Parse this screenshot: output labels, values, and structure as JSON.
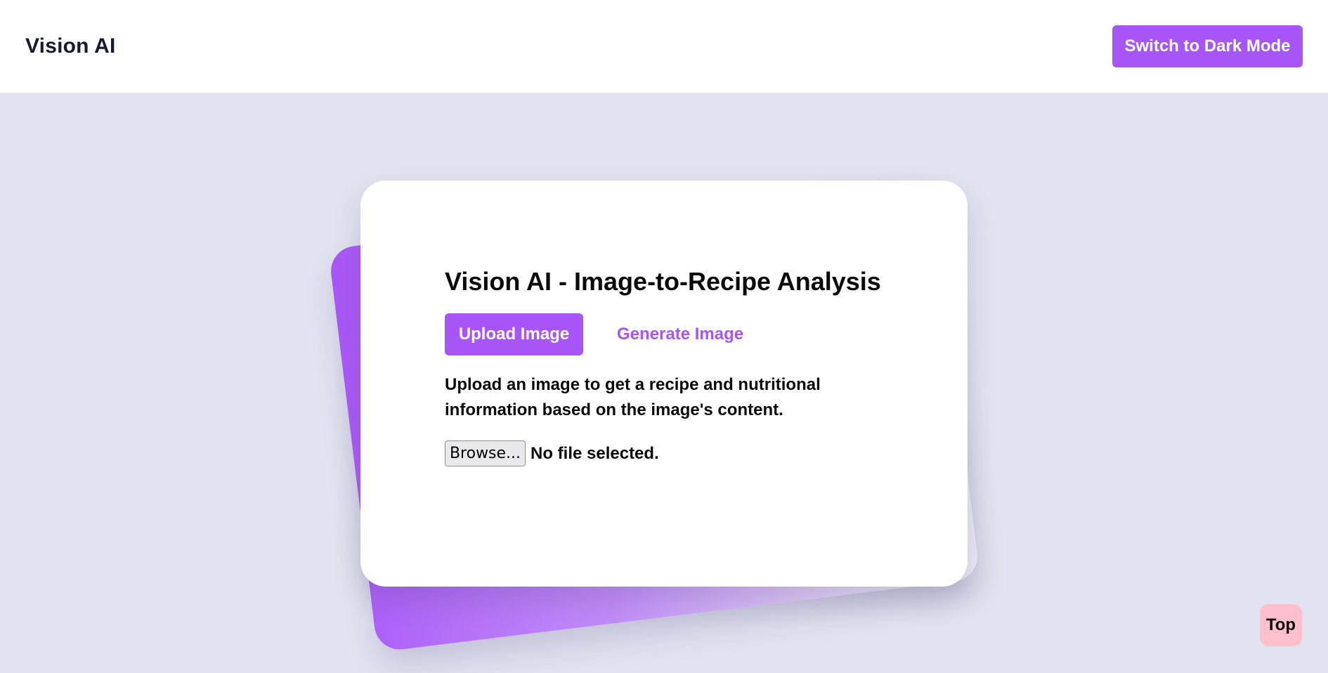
{
  "header": {
    "brand": "Vision AI",
    "theme_toggle_label": "Switch to Dark Mode"
  },
  "card": {
    "title": "Vision AI - Image-to-Recipe Analysis",
    "tabs": [
      {
        "label": "Upload Image",
        "active": true
      },
      {
        "label": "Generate Image",
        "active": false
      }
    ],
    "description": "Upload an image to get a recipe and nutritional information based on the image's content.",
    "file_input": {
      "button_label": "Browse...",
      "status": "No file selected."
    }
  },
  "scroll_top_label": "Top",
  "colors": {
    "accent": "#a855f7",
    "page_background": "#e1e3f0",
    "top_button": "#ffc0cb"
  }
}
